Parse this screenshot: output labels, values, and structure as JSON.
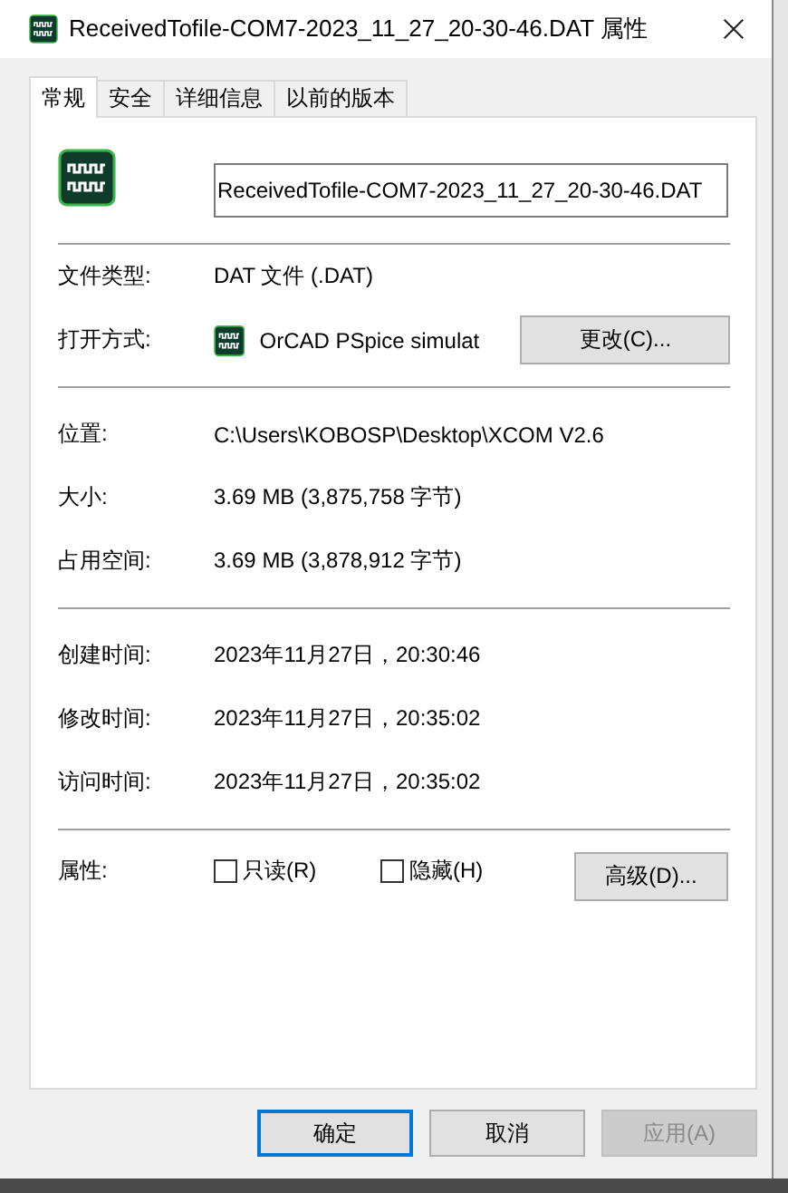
{
  "window": {
    "title": "ReceivedTofile-COM7-2023_11_27_20-30-46.DAT 属性"
  },
  "tabs": [
    {
      "label": "常规",
      "selected": true
    },
    {
      "label": "安全",
      "selected": false
    },
    {
      "label": "详细信息",
      "selected": false
    },
    {
      "label": "以前的版本",
      "selected": false
    }
  ],
  "file_name": {
    "value": "ReceivedTofile-COM7-2023_11_27_20-30-46.DAT"
  },
  "file_type": {
    "label": "文件类型:",
    "value": "DAT 文件 (.DAT)"
  },
  "opens_with": {
    "label": "打开方式:",
    "app": "OrCAD PSpice simulat",
    "button": "更改(C)..."
  },
  "groups": [
    [
      {
        "label": "位置:",
        "value": "C:\\Users\\KOBOSP\\Desktop\\XCOM V2.6"
      },
      {
        "label": "大小:",
        "value": "3.69 MB (3,875,758 字节)"
      },
      {
        "label": "占用空间:",
        "value": "3.69 MB (3,878,912 字节)"
      }
    ],
    [
      {
        "label": "创建时间:",
        "value": "2023年11月27日，20:30:46"
      },
      {
        "label": "修改时间:",
        "value": "2023年11月27日，20:35:02"
      },
      {
        "label": "访问时间:",
        "value": "2023年11月27日，20:35:02"
      }
    ]
  ],
  "attributes": {
    "label": "属性:",
    "checkboxes": [
      {
        "label": "只读(R)",
        "checked": false
      },
      {
        "label": "隐藏(H)",
        "checked": false
      }
    ],
    "button": "高级(D)..."
  },
  "buttons": [
    {
      "label": "确定",
      "default": true,
      "disabled": false
    },
    {
      "label": "取消",
      "default": false,
      "disabled": false
    },
    {
      "label": "应用(A)",
      "default": false,
      "disabled": true
    }
  ]
}
